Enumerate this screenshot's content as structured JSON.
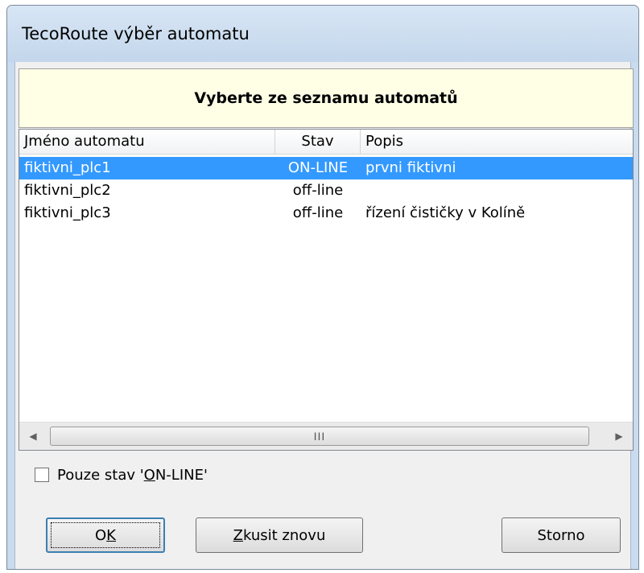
{
  "window": {
    "title": "TecoRoute výběr automatu"
  },
  "banner": {
    "text": "Vyberte ze seznamu automatů"
  },
  "list": {
    "columns": [
      {
        "label": "Jméno automatu"
      },
      {
        "label": "Stav"
      },
      {
        "label": "Popis"
      }
    ],
    "rows": [
      {
        "name": "fiktivni_plc1",
        "status": "ON-LINE",
        "description": "prvni fiktivni",
        "selected": true
      },
      {
        "name": "fiktivni_plc2",
        "status": "off-line",
        "description": "",
        "selected": false
      },
      {
        "name": "fiktivni_plc3",
        "status": "off-line",
        "description": "řízení čističky v Kolíně",
        "selected": false
      }
    ],
    "scrollbar": {
      "grip": "III"
    }
  },
  "filter": {
    "checked": false,
    "label_before": "Pouze stav '",
    "label_mnemonic": "O",
    "label_after": "N-LINE'"
  },
  "buttons": {
    "ok": {
      "prefix": "O",
      "mnemonic": "K",
      "suffix": ""
    },
    "retry": {
      "prefix": "",
      "mnemonic": "Z",
      "suffix": "kusit znovu"
    },
    "cancel": {
      "label": "Storno"
    }
  },
  "colors": {
    "selection": "#3399ff",
    "banner_background": "#ffffe6",
    "titlebar": "#c9dbee"
  }
}
